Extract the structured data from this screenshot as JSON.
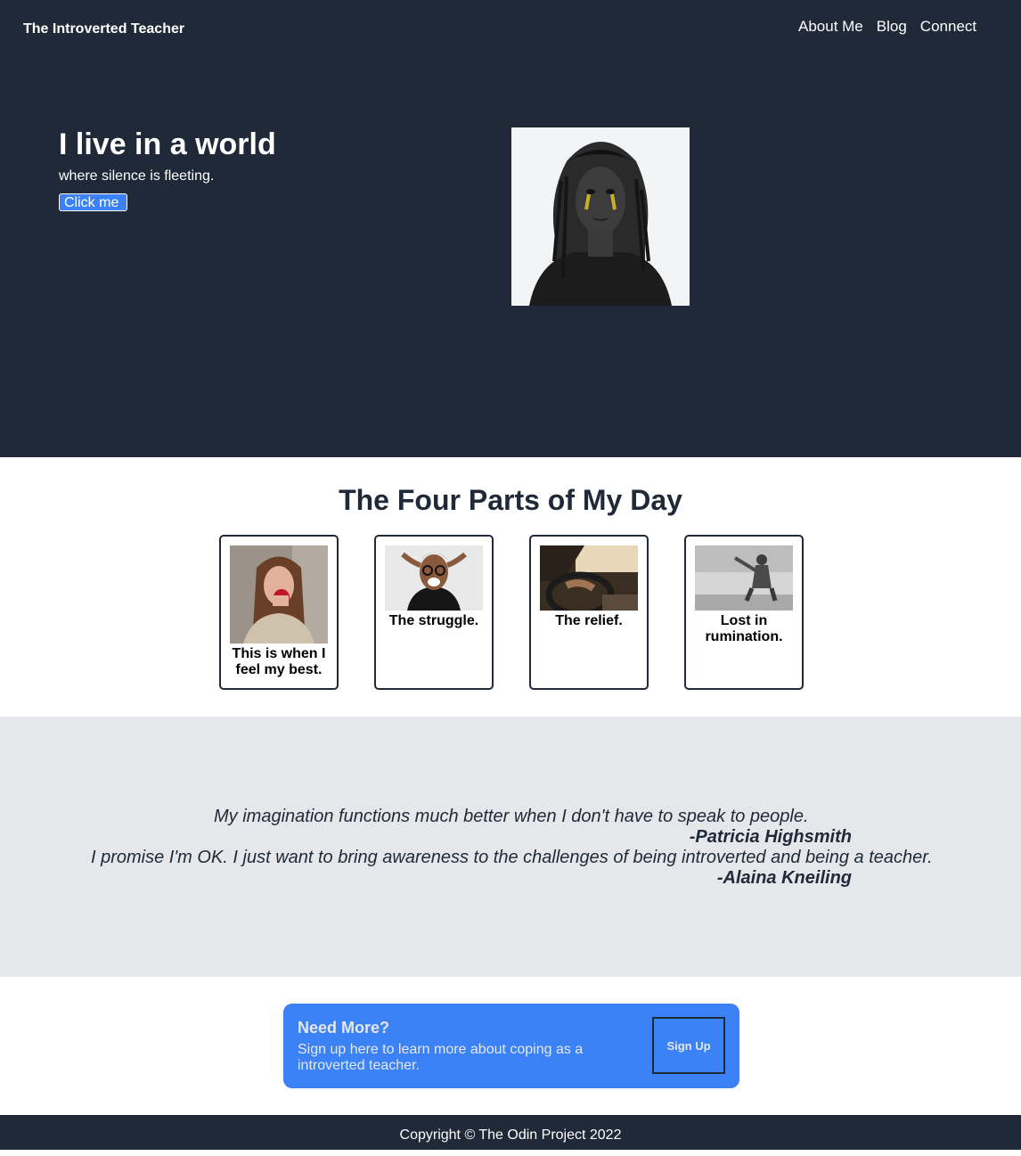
{
  "header": {
    "brand": "The Introverted Teacher",
    "nav": [
      "About Me",
      "Blog",
      "Connect"
    ]
  },
  "hero": {
    "title": "I live in a world",
    "subtitle": "where silence is fleeting.",
    "button_label": "Click me",
    "image_icon": "portrait-photo"
  },
  "parts": {
    "title": "The Four Parts of My Day",
    "cards": [
      {
        "caption": "This is when I feel my best.",
        "image_icon": "woman-with-mug-photo"
      },
      {
        "caption": "The struggle.",
        "image_icon": "stressed-man-photo"
      },
      {
        "caption": "The relief.",
        "image_icon": "driving-photo"
      },
      {
        "caption": "Lost in rumination.",
        "image_icon": "man-sitting-by-sea-photo"
      }
    ]
  },
  "quotes": [
    {
      "text": "My imagination functions much better when I don't have to speak to people.",
      "author": "-Patricia Highsmith"
    },
    {
      "text": "I promise I'm OK. I just want to bring awareness to the challenges of being introverted and being a teacher.",
      "author": "-Alaina Kneiling"
    }
  ],
  "cta": {
    "title": "Need More?",
    "text": "Sign up here to learn more about coping as a introverted teacher.",
    "button_label": "Sign Up"
  },
  "footer": {
    "copyright": "Copyright © The Odin Project 2022"
  },
  "colors": {
    "dark": "#1f2937",
    "accent": "#3b82f6",
    "light_gray": "#e5e7eb"
  }
}
